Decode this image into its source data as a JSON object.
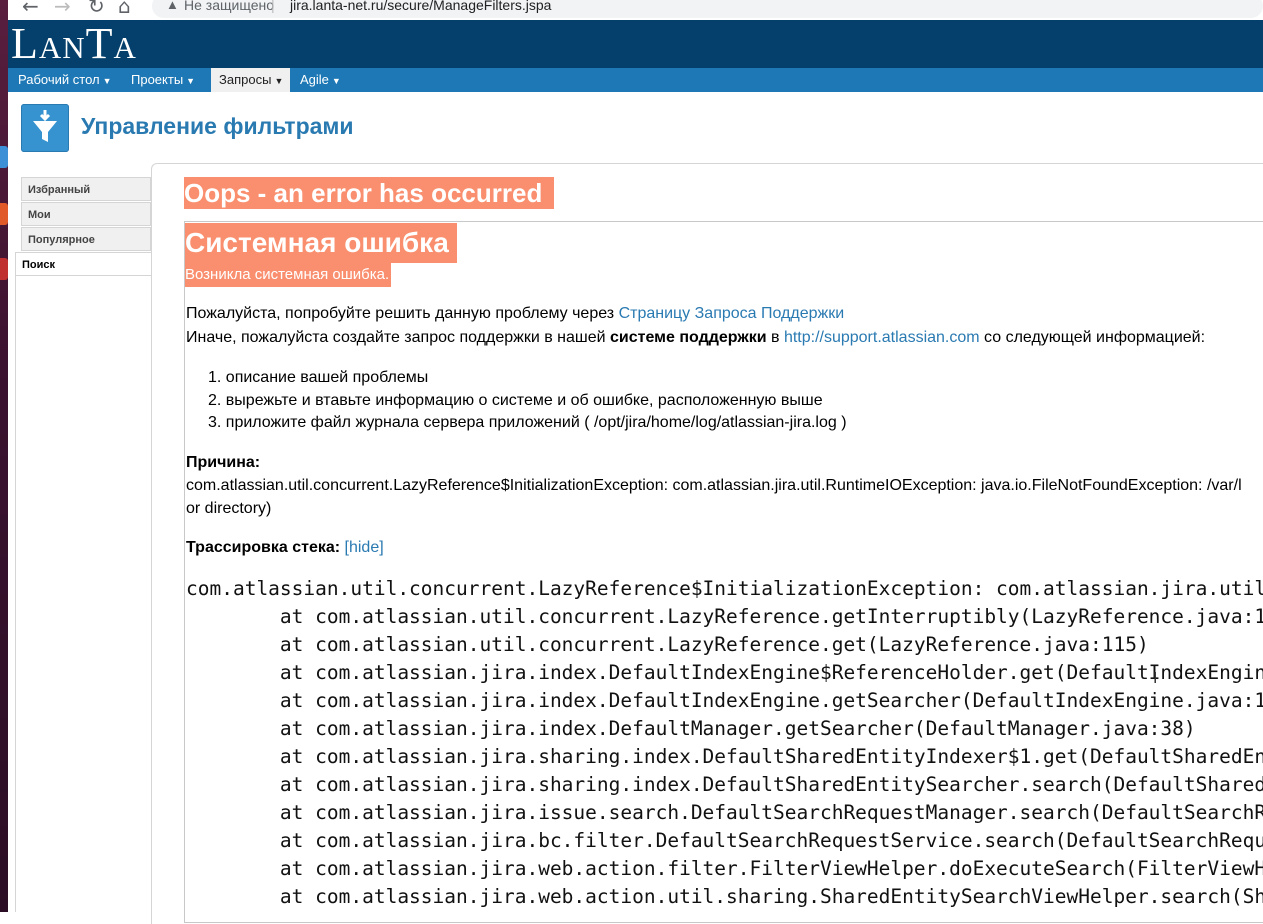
{
  "browser": {
    "back_icon": "←",
    "forward_icon": "→",
    "reload_icon": "↻",
    "home_icon": "⌂",
    "security_label": "Не защищено",
    "separator": "|",
    "url": "jira.lanta-net.ru/secure/ManageFilters.jspa"
  },
  "header": {
    "logo_text": "LanTa"
  },
  "menu": {
    "items": [
      {
        "label": "Рабочий стол"
      },
      {
        "label": "Проекты"
      },
      {
        "label": "Запросы"
      },
      {
        "label": "Agile"
      }
    ],
    "active": "Запросы"
  },
  "page": {
    "title": "Управление фильтрами"
  },
  "sidebar": {
    "items": [
      {
        "label": "Избранный"
      },
      {
        "label": "Мои"
      },
      {
        "label": "Популярное"
      },
      {
        "label": "Поиск"
      }
    ]
  },
  "error": {
    "oops_title": "Oops - an error has occurred",
    "system_title": "Системная ошибка",
    "system_subtitle": "Возникла системная ошибка.",
    "line1_prefix": "Пожалуйста, попробуйте решить данную проблему через ",
    "line1_link": "Страницу Запроса Поддержки",
    "line2_prefix": "Иначе, пожалуйста создайте запрос поддержки в нашей ",
    "line2_bold": "системе поддержки",
    "line2_mid": " в ",
    "line2_link": "http://support.atlassian.com",
    "line2_suffix": " со следующей информацией:",
    "steps": [
      "1. описание вашей проблемы",
      "2. вырежьте и втавьте информацию о системе и об ошибке, расположенную выше",
      "3. приложите файл журнала сервера приложений ( /opt/jira/home/log/atlassian-jira.log )"
    ],
    "cause_label": "Причина:",
    "cause_line1": "com.atlassian.util.concurrent.LazyReference$InitializationException: com.atlassian.jira.util.RuntimeIOException: java.io.FileNotFoundException: /var/l",
    "cause_line2": "or directory)",
    "stack_label": "Трассировка стека:",
    "stack_hide": "[hide]",
    "stack_lines": [
      "com.atlassian.util.concurrent.LazyReference$InitializationException: com.atlassian.jira.util",
      "        at com.atlassian.util.concurrent.LazyReference.getInterruptibly(LazyReference.java:1",
      "        at com.atlassian.util.concurrent.LazyReference.get(LazyReference.java:115)",
      "        at com.atlassian.jira.index.DefaultIndexEngine$ReferenceHolder.get(DefaultIndexEngin",
      "        at com.atlassian.jira.index.DefaultIndexEngine.getSearcher(DefaultIndexEngine.java:1",
      "        at com.atlassian.jira.index.DefaultManager.getSearcher(DefaultManager.java:38)",
      "        at com.atlassian.jira.sharing.index.DefaultSharedEntityIndexer$1.get(DefaultSharedEn",
      "        at com.atlassian.jira.sharing.index.DefaultSharedEntitySearcher.search(DefaultShared",
      "        at com.atlassian.jira.issue.search.DefaultSearchRequestManager.search(DefaultSearchR",
      "        at com.atlassian.jira.bc.filter.DefaultSearchRequestService.search(DefaultSearchRequ",
      "        at com.atlassian.jira.web.action.filter.FilterViewHelper.doExecuteSearch(FilterViewH",
      "        at com.atlassian.jira.web.action.util.sharing.SharedEntitySearchViewHelper.search(Sh"
    ]
  },
  "colors": {
    "header_bg": "#04406b",
    "menu_bg": "#1d78b5",
    "error_bg": "#f98f6e",
    "link": "#2a7ab2"
  }
}
